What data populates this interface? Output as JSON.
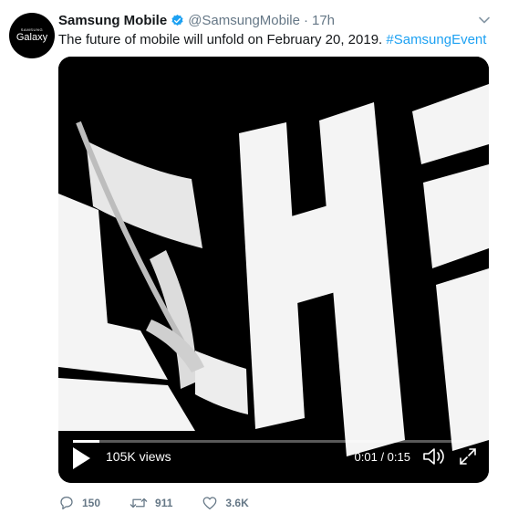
{
  "avatar": {
    "brand_small": "SAMSUNG",
    "brand_big": "Galaxy"
  },
  "tweet": {
    "display_name": "Samsung Mobile",
    "handle": "@SamsungMobile",
    "separator": "·",
    "time": "17h",
    "text": "The future of mobile will unfold on February 20, 2019.",
    "hashtag": "#SamsungEvent"
  },
  "video": {
    "views": "105K views",
    "time_readout": "0:01 / 0:15",
    "progress": 0.067
  },
  "actions": {
    "replies": "150",
    "retweets": "911",
    "likes": "3.6K"
  },
  "colors": {
    "accent": "#1da1f2",
    "muted": "#657786",
    "text": "#14171a",
    "media_bg": "#000000"
  },
  "icons": {
    "verified": "verified-badge-icon",
    "caret": "chevron-down-icon",
    "play": "play-icon",
    "volume": "volume-icon",
    "fullscreen": "expand-icon",
    "reply": "reply-icon",
    "retweet": "retweet-icon",
    "like": "heart-icon"
  }
}
